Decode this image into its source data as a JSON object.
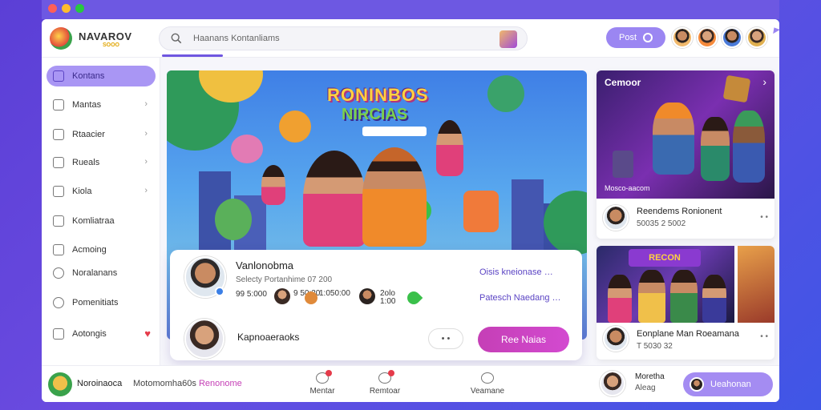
{
  "window": {
    "traffic_lights": [
      "#ff5f57",
      "#febc2e",
      "#28c840"
    ]
  },
  "header": {
    "brand": "NAVAROV",
    "brand_sub": "SOOO",
    "search_text": "Haanans Kontanliams",
    "button_label": "Post",
    "avatar_colors": [
      "#f0b86b",
      "#f58a3b",
      "#4a7ad8",
      "#e0b050"
    ]
  },
  "sidebar": {
    "items": [
      {
        "label": "Kontans",
        "active": true,
        "chevron": false,
        "icon": "home-icon"
      },
      {
        "label": "Mantas",
        "active": false,
        "chevron": true,
        "icon": "grid-icon"
      },
      {
        "label": "Rtaacier",
        "active": false,
        "chevron": true,
        "icon": "list-icon"
      },
      {
        "label": "Rueals",
        "active": false,
        "chevron": true,
        "icon": "edit-icon"
      },
      {
        "label": "Kiola",
        "active": false,
        "chevron": true,
        "icon": "star-icon"
      },
      {
        "label": "Komliatraa",
        "active": false,
        "chevron": false,
        "icon": "chat-icon"
      },
      {
        "label": "Acmoing",
        "active": false,
        "chevron": false,
        "icon": "pin-icon"
      },
      {
        "label": "Noralanans",
        "active": false,
        "chevron": false,
        "icon": "clock-icon"
      },
      {
        "label": "Pomenitiats",
        "active": false,
        "chevron": false,
        "icon": "refresh-icon"
      },
      {
        "label": "Aotongis",
        "active": false,
        "chevron": false,
        "icon": "mail-icon",
        "heart": true
      }
    ]
  },
  "banner": {
    "title_line1": "RONINBOS",
    "title_line2": "NIRCIAS"
  },
  "info_card": {
    "name": "Vanlonobma",
    "subtitle": "Selecty Portanhime 07 200",
    "stats_left": "99 5:000",
    "mini_1_label": "9 50:30",
    "mini_2_label": "1:050:00",
    "mini_3_label": "2olo 1:00",
    "link_1": "Oisis kneionase …",
    "link_2": "Patesch Naedang …",
    "row2_name": "Kapnoaeraoks",
    "more_button": "• •",
    "cta_button": "Ree Naias"
  },
  "right_card_1": {
    "label": "Cemoor",
    "tag": "Mosco-aacom",
    "name": "Reendems Ronionent",
    "meta": "50035 2 5002",
    "more": "• •"
  },
  "right_card_2": {
    "sign": "RECON",
    "name": "Eonplane Man Roeamana",
    "meta": "T 5030 32",
    "more": "• •"
  },
  "bottom_bar": {
    "user_name": "Noroinaoca",
    "text_prefix": "Motomomha60s ",
    "text_accent": "Renonome",
    "nav": [
      {
        "label": "Mentar",
        "badge": true
      },
      {
        "label": "Remtoar",
        "badge": true
      },
      {
        "label": "Veamane",
        "badge": false
      }
    ],
    "right_name": "Moretha",
    "right_sub": "Aleag",
    "cta": "Ueahonan"
  }
}
